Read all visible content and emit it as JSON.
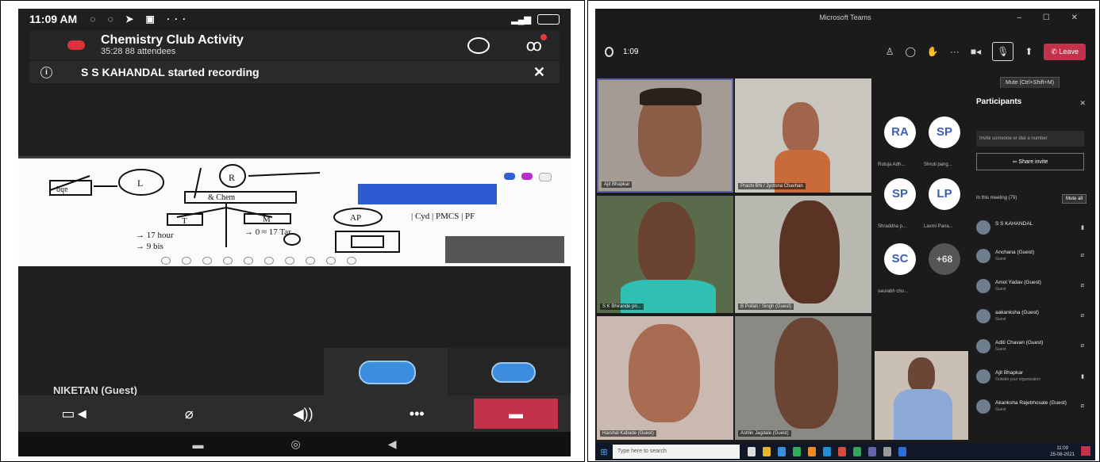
{
  "phone": {
    "status_time": "11:09 AM",
    "call_title": "Chemistry Club Activity",
    "call_subtitle": "35:28  88 attendees",
    "notice_text": "S S KAHANDAL started recording",
    "notice_close": "✕",
    "tile_name": "NIKETAN (Guest)",
    "more_label": "•••",
    "whiteboard": {
      "main_label": "& Chem",
      "label_r": "R",
      "label_l": "L",
      "label_t": "T",
      "label_m": "M",
      "label_ap": "AP",
      "scrawl_right": "| Cyd | PMCS | PF",
      "scrawl_left1": "→ 17 hour",
      "scrawl_left2": "→ 9 bis",
      "scrawl_mid": "→ 0 ≈ 17 Tar",
      "scrawl_top": "ƃɥɐ"
    }
  },
  "teams": {
    "window_title": "Microsoft Teams",
    "window_controls": "– ☐ ✕",
    "timer": "1:09",
    "leave_label": "Leave",
    "mic_tooltip": "Mute (Ctrl+Shift+M)",
    "participants_title": "Participants",
    "invite_placeholder": "Invite someone or dial a number",
    "share_invite": "Share invite",
    "in_meeting": "In this meeting (79)",
    "mute_all": "Mute all",
    "videos": [
      {
        "label": "Ajit Bhapkar"
      },
      {
        "label": "Prachi Bhi / Jyotsna Chavhan"
      },
      {
        "label": "S K Bhirande pri..."
      },
      {
        "label": "B Pollati / Singh (Guest)"
      },
      {
        "label": "Harshal Kabade (Guest)"
      },
      {
        "label": "Ashlin Jagdale (Guest)"
      }
    ],
    "roster": [
      {
        "initials": "RA",
        "name": "Rutuja Adh..."
      },
      {
        "initials": "SP",
        "name": "Shruti pang..."
      },
      {
        "initials": "SP",
        "name": "Shraddha p..."
      },
      {
        "initials": "LP",
        "name": "Laxmi Pana..."
      },
      {
        "initials": "SC",
        "name": "saurabh cho..."
      },
      {
        "initials": "+68",
        "name": ""
      }
    ],
    "participants": [
      {
        "name": "S S KAHANDAL",
        "sub": ""
      },
      {
        "name": "Anchana (Guest)",
        "sub": "Guest"
      },
      {
        "name": "Amol Yadav (Guest)",
        "sub": "Guest"
      },
      {
        "name": "aakanksha (Guest)",
        "sub": "Guest"
      },
      {
        "name": "Aditi Chavan (Guest)",
        "sub": "Guest"
      },
      {
        "name": "Ajit Bhapkar",
        "sub": "Outside your organization"
      },
      {
        "name": "Akanksha Rajebhosale (Guest)",
        "sub": "Guest"
      }
    ],
    "taskbar_search": "Type here to search",
    "clock_time": "11:09",
    "clock_date": "25-08-2021"
  },
  "colors": {
    "teams_purple": "#6264a7",
    "record_red": "#d9343b",
    "avatar_blue": "#3c8dde",
    "leave_red": "#c4314b"
  }
}
